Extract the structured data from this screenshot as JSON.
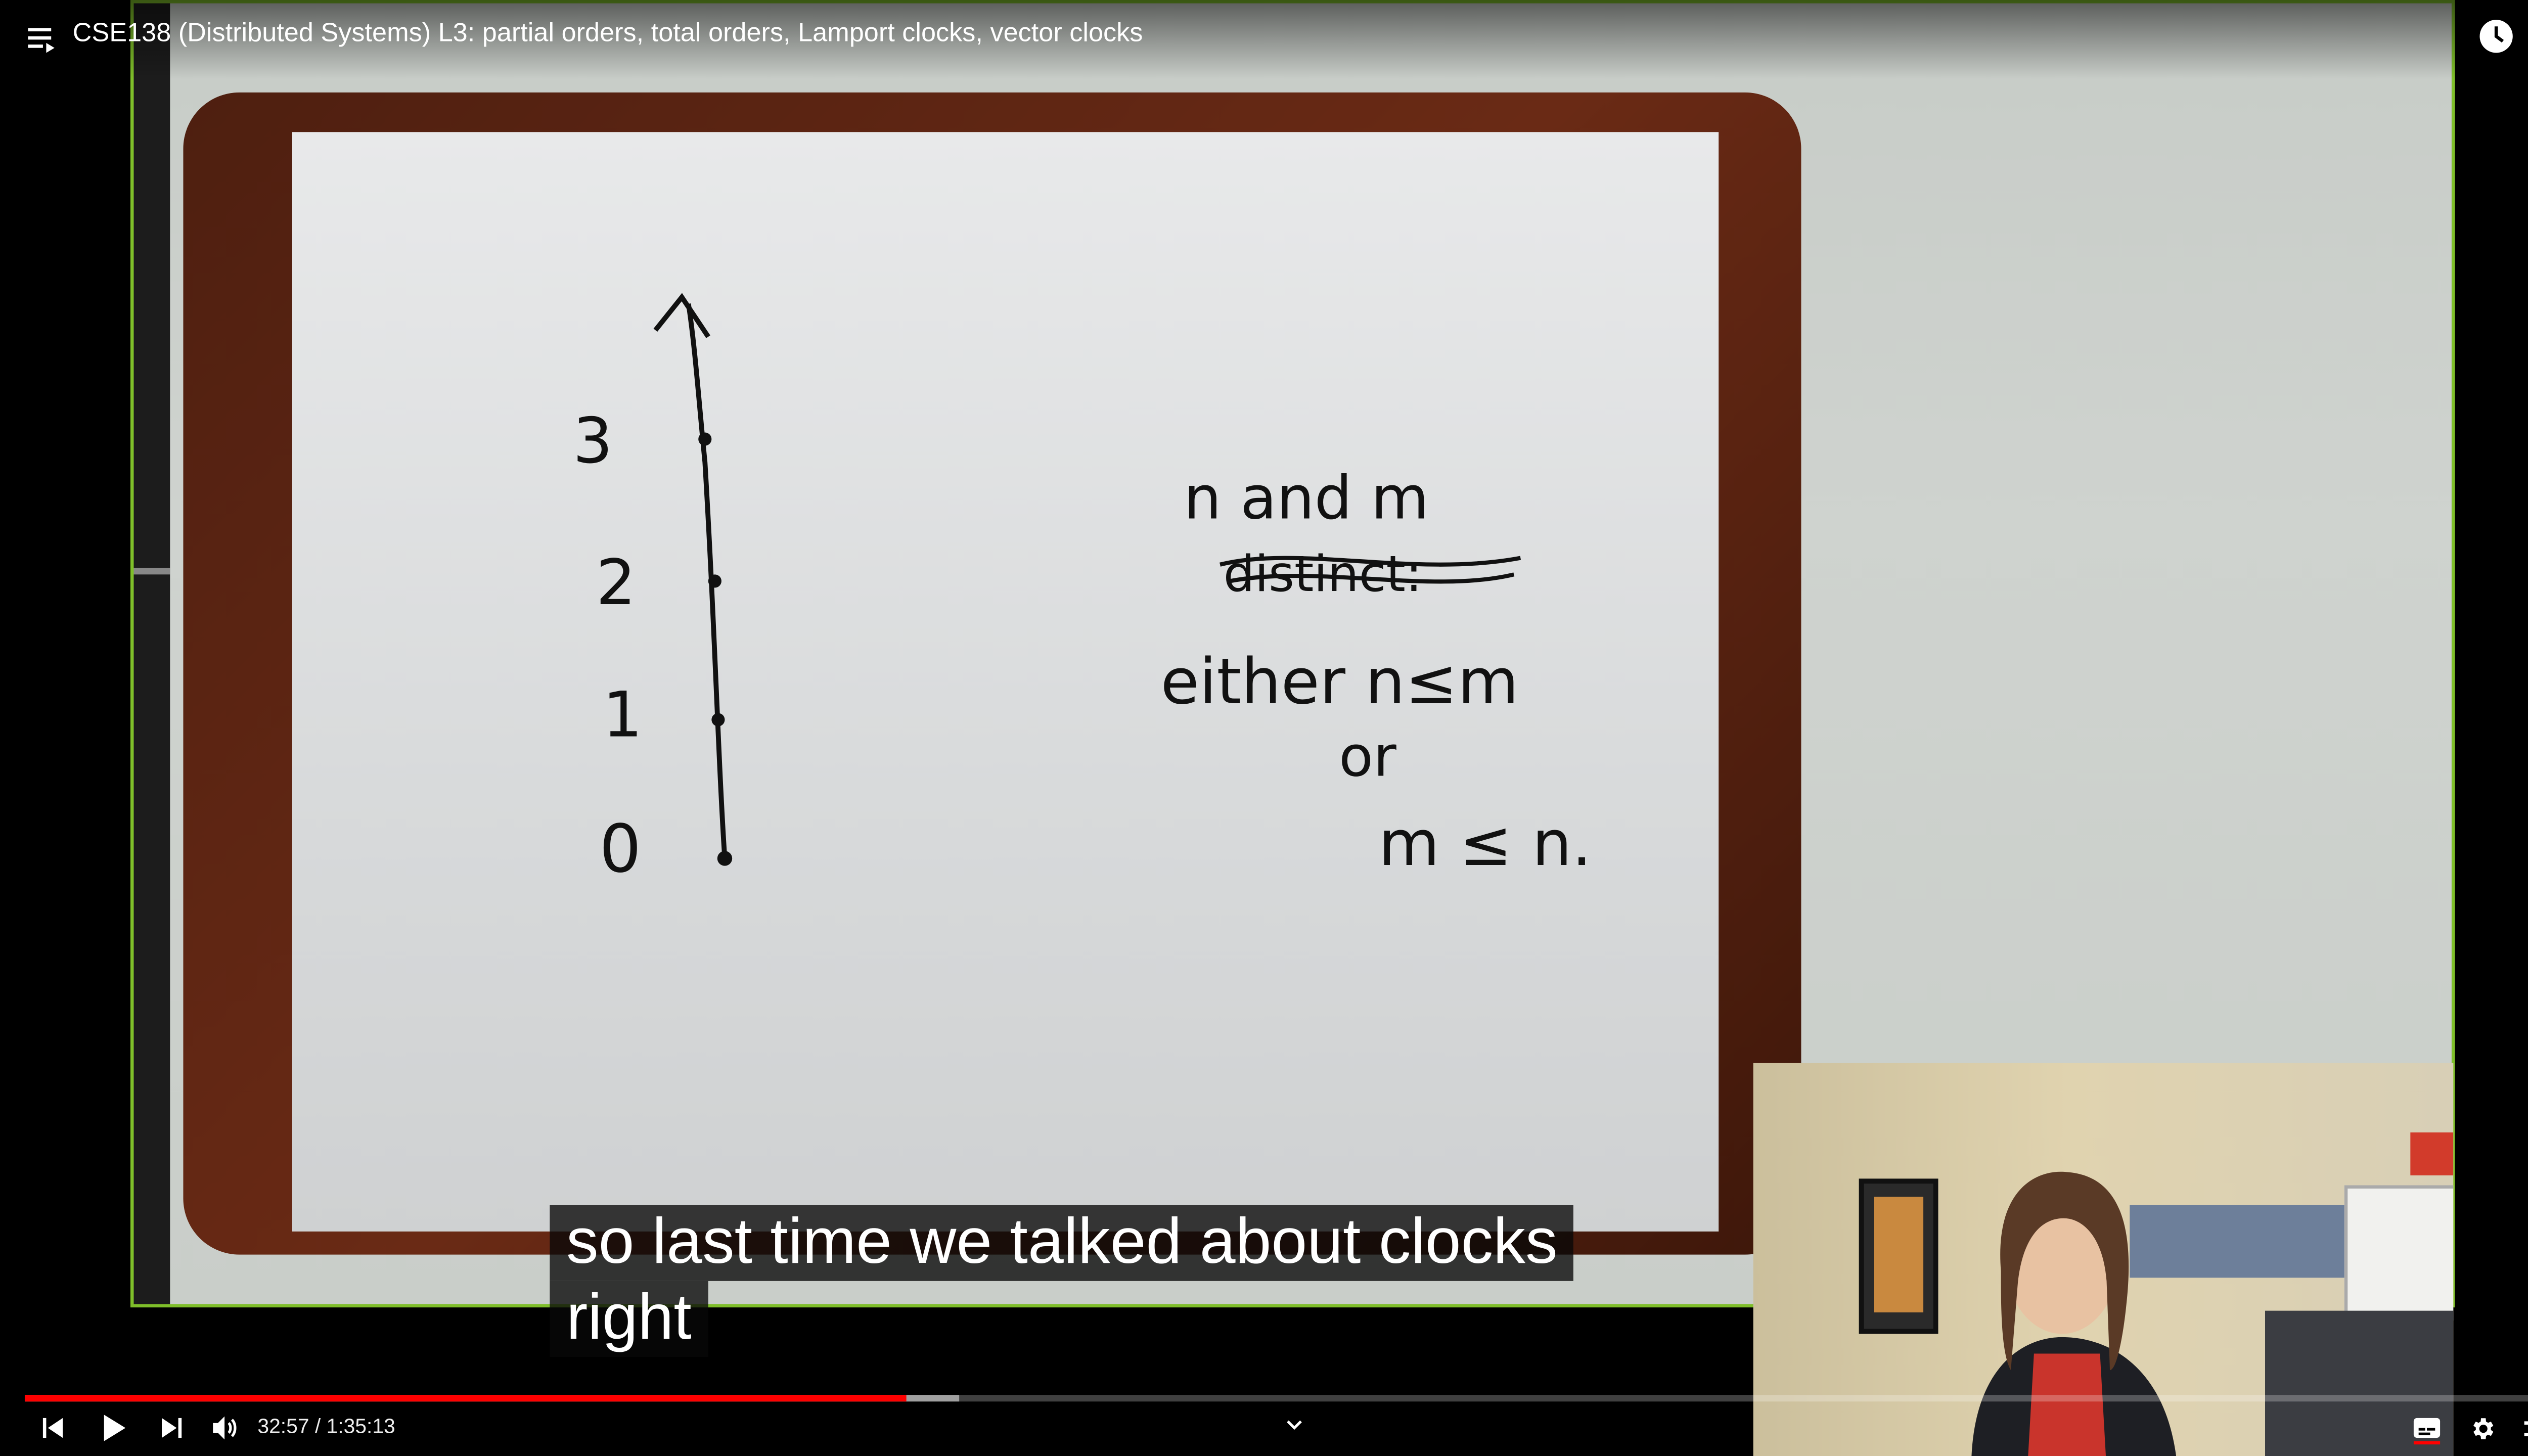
{
  "player": {
    "title": "CSE138 (Distributed Systems) L3: partial orders, total orders, Lamport clocks, vector clocks",
    "time_display": "32:57 / 1:35:13",
    "progress": {
      "played_fraction": 0.347,
      "buffered_fraction": 0.368
    },
    "accent_color": "#ff0000"
  },
  "whiteboard": {
    "axis_labels": [
      "3",
      "2",
      "1",
      "0"
    ],
    "text_lines": [
      "n and m",
      "distinct:",
      "either n≤m",
      "or",
      "m ≤ n."
    ]
  },
  "captions": {
    "line1": "so last time we talked about clocks",
    "line2": "right"
  },
  "icons": {
    "menu": "playlist-icon",
    "watch_later": "clock-icon",
    "share": "share-icon",
    "prev": "skip-previous-icon",
    "play": "play-icon",
    "next": "skip-next-icon",
    "volume": "volume-icon",
    "chevron": "chevron-down-icon",
    "subtitles": "subtitles-icon",
    "settings": "gear-icon",
    "exit_fullscreen": "exit-fullscreen-icon"
  }
}
